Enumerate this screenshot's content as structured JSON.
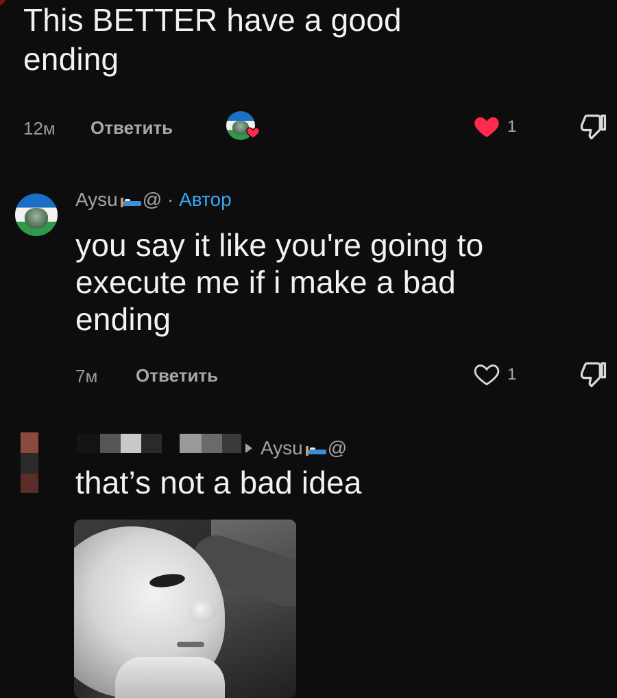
{
  "comment1": {
    "text": "This BETTER have a good\nending",
    "time": "12м",
    "reply_label": "Ответить",
    "like_count": "1"
  },
  "comment2": {
    "username": "Aysu",
    "username_suffix": "@",
    "separator": " · ",
    "author_badge": "Автор",
    "text": "you say it like you're going to\nexecute me if i make a bad\nending",
    "time": "7м",
    "reply_label": "Ответить",
    "like_count": "1"
  },
  "comment3": {
    "reply_to_user": "Aysu",
    "reply_to_suffix": "@",
    "text": "that’s not a bad idea"
  },
  "colors": {
    "background": "#0d0d0d",
    "liked_heart": "#ff2a4d",
    "author_badge": "#35a7f2",
    "meta_text": "#9a9a9a"
  },
  "icons": {
    "liked": "heart-filled-icon",
    "unliked": "heart-outline-icon",
    "dislike": "thumbs-down-icon",
    "reply_arrow": "caret-right-icon"
  }
}
